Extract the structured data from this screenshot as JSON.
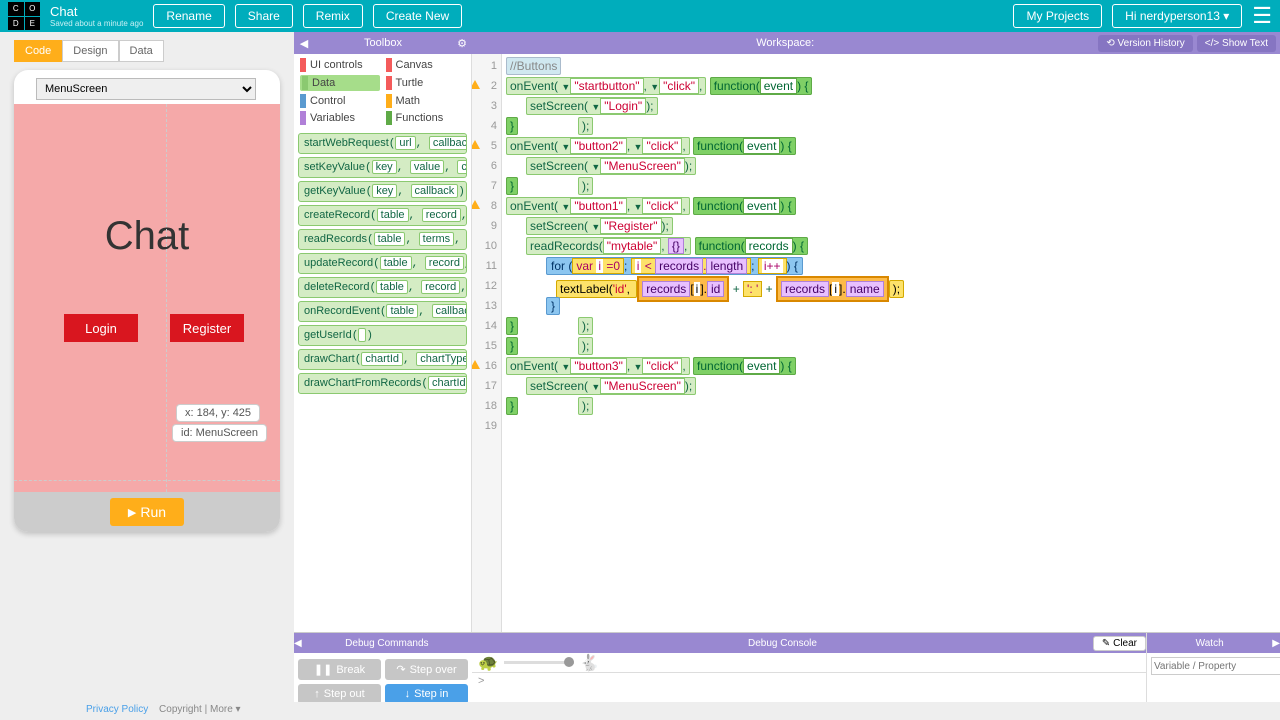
{
  "header": {
    "project_title": "Chat",
    "saved_text": "Saved about a minute ago",
    "btn_rename": "Rename",
    "btn_share": "Share",
    "btn_remix": "Remix",
    "btn_create_new": "Create New",
    "btn_my_projects": "My Projects",
    "user_greeting": "Hi nerdyperson13"
  },
  "tabs": {
    "code": "Code",
    "design": "Design",
    "data": "Data"
  },
  "phone": {
    "screen_selected": "MenuScreen",
    "title_label": "Chat",
    "btn_login": "Login",
    "btn_register": "Register",
    "tooltip_xy": "x: 184, y: 425",
    "tooltip_id": "id: MenuScreen",
    "btn_run": "Run"
  },
  "toolbox": {
    "header": "Toolbox",
    "categories": [
      {
        "name": "UI controls",
        "color": "#f45b5b"
      },
      {
        "name": "Canvas",
        "color": "#f45b5b"
      },
      {
        "name": "Data",
        "color": "#8bc970",
        "selected": true
      },
      {
        "name": "Turtle",
        "color": "#f45b5b"
      },
      {
        "name": "Control",
        "color": "#5a9ad0"
      },
      {
        "name": "Math",
        "color": "#ffae1a"
      },
      {
        "name": "Variables",
        "color": "#b080d8"
      },
      {
        "name": "Functions",
        "color": "#5faa47"
      }
    ],
    "blocks": [
      "startWebRequest(url, callback)",
      "setKeyValue(key, value, call...)",
      "getKeyValue(key, callback)",
      "createRecord(table, record, ...)",
      "readRecords(table, terms, ca...)",
      "updateRecord(table, record, ...)",
      "deleteRecord(table, record, ...)",
      "onRecordEvent(table, callback)",
      "getUserId()",
      "drawChart(chartId, chartType, ...)",
      "drawChartFromRecords(chartId, ...)"
    ]
  },
  "workspace": {
    "header": "Workspace:",
    "btn_version": "Version History",
    "btn_show_text": "Show Text",
    "code_lines": [
      {
        "n": 1,
        "type": "comment",
        "text": "//Buttons"
      },
      {
        "n": 2,
        "warn": true,
        "type": "onevent",
        "target": "startbutton",
        "ev": "click"
      },
      {
        "n": 3,
        "type": "setscreen",
        "screen": "Login"
      },
      {
        "n": 4,
        "type": "close"
      },
      {
        "n": 5,
        "warn": true,
        "type": "onevent",
        "target": "button2",
        "ev": "click"
      },
      {
        "n": 6,
        "type": "setscreen",
        "screen": "MenuScreen"
      },
      {
        "n": 7,
        "type": "close"
      },
      {
        "n": 8,
        "warn": true,
        "type": "onevent",
        "target": "button1",
        "ev": "click"
      },
      {
        "n": 9,
        "type": "setscreen",
        "screen": "Register"
      },
      {
        "n": 10,
        "type": "readrecords",
        "table": "mytable"
      },
      {
        "n": 11,
        "type": "for"
      },
      {
        "n": 12,
        "type": "textlabel"
      },
      {
        "n": 13,
        "type": "closebrace"
      },
      {
        "n": 14,
        "type": "close"
      },
      {
        "n": 15,
        "type": "close"
      },
      {
        "n": 16,
        "warn": true,
        "type": "onevent",
        "target": "button3",
        "ev": "click"
      },
      {
        "n": 17,
        "type": "setscreen",
        "screen": "MenuScreen"
      },
      {
        "n": 18,
        "type": "close"
      },
      {
        "n": 19,
        "type": "empty"
      }
    ]
  },
  "debug": {
    "commands_header": "Debug Commands",
    "console_header": "Debug Console",
    "watch_header": "Watch",
    "btn_break": "Break",
    "btn_stepover": "Step over",
    "btn_stepout": "Step out",
    "btn_stepin": "Step in",
    "btn_clear": "Clear",
    "watch_placeholder": "Variable / Property"
  },
  "footer": {
    "privacy": "Privacy Policy",
    "copyright": "Copyright",
    "more": "More ▾"
  }
}
